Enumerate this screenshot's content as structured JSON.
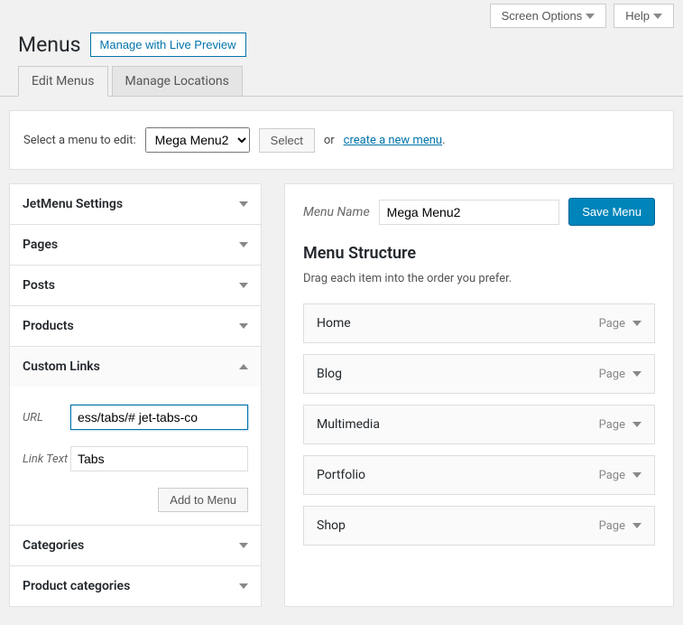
{
  "top_tabs": {
    "screen_options": "Screen Options",
    "help": "Help"
  },
  "header": {
    "title": "Menus",
    "live_preview": "Manage with Live Preview"
  },
  "tabs": {
    "edit": "Edit Menus",
    "locations": "Manage Locations"
  },
  "select_row": {
    "label": "Select a menu to edit:",
    "selected": "Mega Menu2",
    "select_btn": "Select",
    "or": "or",
    "create_link": "create a new menu",
    "period": "."
  },
  "accordion": {
    "items": [
      {
        "label": "JetMenu Settings"
      },
      {
        "label": "Pages"
      },
      {
        "label": "Posts"
      },
      {
        "label": "Products"
      },
      {
        "label": "Custom Links"
      },
      {
        "label": "Categories"
      },
      {
        "label": "Product categories"
      }
    ],
    "custom_links": {
      "url_label": "URL",
      "url_value": "ess/tabs/# jet-tabs-co",
      "link_text_label": "Link Text",
      "link_text_value": "Tabs",
      "add_btn": "Add to Menu"
    }
  },
  "menu": {
    "name_label": "Menu Name",
    "name_value": "Mega Menu2",
    "save_btn": "Save Menu",
    "structure_title": "Menu Structure",
    "structure_desc": "Drag each item into the order you prefer.",
    "items": [
      {
        "label": "Home",
        "type": "Page"
      },
      {
        "label": "Blog",
        "type": "Page"
      },
      {
        "label": "Multimedia",
        "type": "Page"
      },
      {
        "label": "Portfolio",
        "type": "Page"
      },
      {
        "label": "Shop",
        "type": "Page"
      }
    ]
  }
}
